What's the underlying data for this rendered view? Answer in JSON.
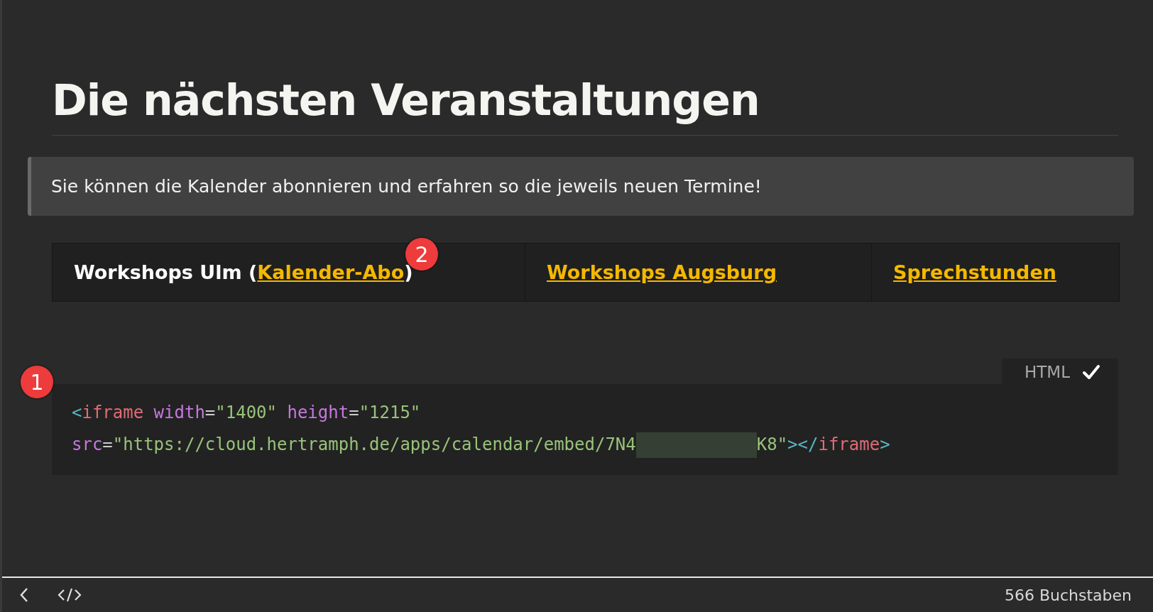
{
  "title": "Die nächsten Veranstaltungen",
  "callout": "Sie können die Kalender abonnieren und erfahren so die jeweils neuen Termine!",
  "tabs": [
    {
      "label": "Workshops Ulm",
      "open": " (",
      "link": "Kalender-Abo",
      "close": ")",
      "badge": "2"
    },
    {
      "link": "Workshops Augsburg"
    },
    {
      "link": "Sprechstunden"
    }
  ],
  "code_block": {
    "language": "HTML",
    "badge": "1",
    "lines": [
      [
        {
          "kind": "punct",
          "text": "<"
        },
        {
          "kind": "tag",
          "text": "iframe "
        },
        {
          "kind": "attr",
          "text": "width"
        },
        {
          "kind": "plain",
          "text": "="
        },
        {
          "kind": "string",
          "text": "\"1400\" "
        },
        {
          "kind": "attr",
          "text": "height"
        },
        {
          "kind": "plain",
          "text": "="
        },
        {
          "kind": "string",
          "text": "\"1215\""
        }
      ],
      [
        {
          "kind": "attr",
          "text": "src"
        },
        {
          "kind": "plain",
          "text": "="
        },
        {
          "kind": "string",
          "text": "\"https://cloud.hertramph.de/apps/calendar/embed/7N4"
        },
        {
          "kind": "redacted"
        },
        {
          "kind": "string",
          "text": "K8\""
        },
        {
          "kind": "punct",
          "text": "></"
        },
        {
          "kind": "tag",
          "text": "iframe"
        },
        {
          "kind": "punct",
          "text": ">"
        }
      ]
    ]
  },
  "status_bar": {
    "count": "566 Buchstaben"
  }
}
